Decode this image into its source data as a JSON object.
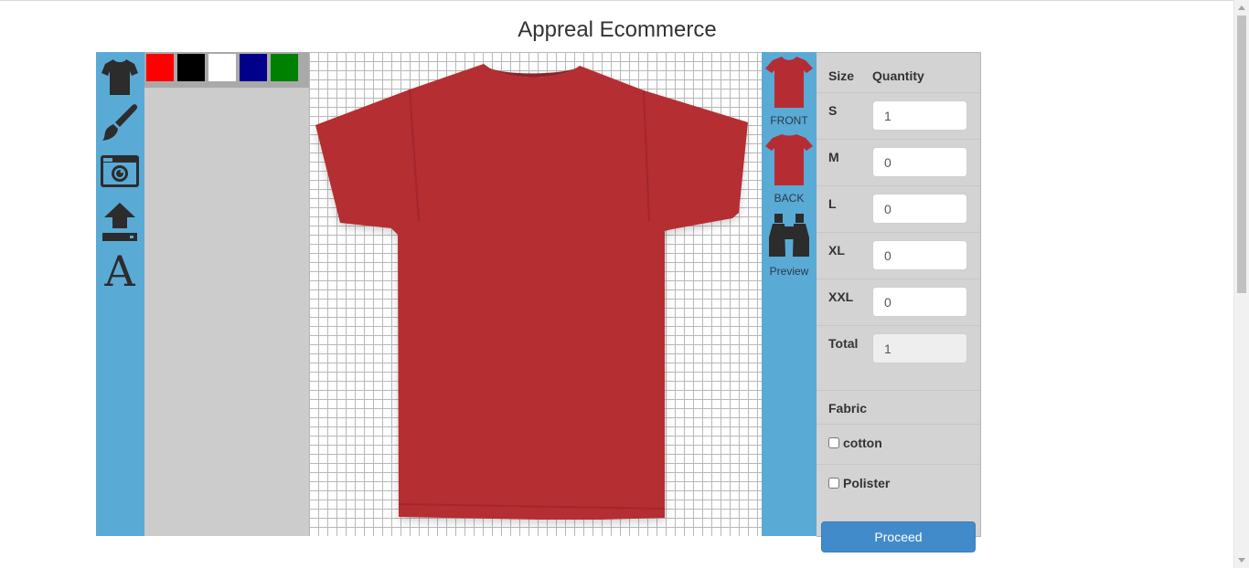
{
  "page": {
    "title": "Appreal Ecommerce"
  },
  "toolbar": {
    "tools": [
      {
        "name": "tshirt-icon"
      },
      {
        "name": "paint-brush-icon"
      },
      {
        "name": "camera-icon"
      },
      {
        "name": "upload-icon"
      },
      {
        "name": "text-icon",
        "glyph": "A"
      }
    ]
  },
  "colors": {
    "swatches": [
      "#ff0000",
      "#000000",
      "#ffffff",
      "#00008b",
      "#008000"
    ],
    "shirt_color": "#b52d33",
    "toolbar_bg": "#5aaad6"
  },
  "views": {
    "front_label": "FRONT",
    "back_label": "BACK",
    "preview_label": "Preview"
  },
  "order": {
    "size_header": "Size",
    "quantity_header": "Quantity",
    "sizes": [
      {
        "label": "S",
        "value": "1"
      },
      {
        "label": "M",
        "value": "0"
      },
      {
        "label": "L",
        "value": "0"
      },
      {
        "label": "XL",
        "value": "0"
      },
      {
        "label": "XXL",
        "value": "0"
      }
    ],
    "total_label": "Total",
    "total_value": "1",
    "fabric_label": "Fabric",
    "fabric_options": [
      "cotton",
      "Polister"
    ],
    "proceed_label": "Proceed"
  }
}
